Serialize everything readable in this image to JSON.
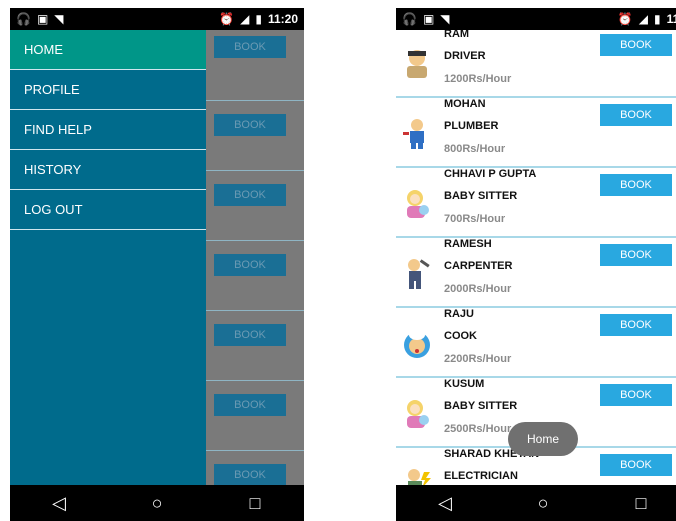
{
  "status": {
    "time_left": "11:20",
    "time_right": "11:2"
  },
  "drawer": {
    "items": [
      {
        "label": "HOME",
        "active": true
      },
      {
        "label": "PROFILE"
      },
      {
        "label": "FIND HELP"
      },
      {
        "label": "HISTORY"
      },
      {
        "label": "LOG OUT"
      }
    ]
  },
  "book_label": "BOOK",
  "list": {
    "items": [
      {
        "name": "RAM",
        "profession": "DRIVER",
        "rate": "1200Rs/Hour",
        "icon": "driver-avatar-icon"
      },
      {
        "name": "MOHAN",
        "profession": "PLUMBER",
        "rate": "800Rs/Hour",
        "icon": "plumber-avatar-icon"
      },
      {
        "name": "CHHAVI P GUPTA",
        "profession": "BABY SITTER",
        "rate": "700Rs/Hour",
        "icon": "baby-sitter-avatar-icon"
      },
      {
        "name": "RAMESH",
        "profession": "CARPENTER",
        "rate": "2000Rs/Hour",
        "icon": "carpenter-avatar-icon"
      },
      {
        "name": "RAJU",
        "profession": "COOK",
        "rate": "2200Rs/Hour",
        "icon": "cook-avatar-icon"
      },
      {
        "name": "KUSUM",
        "profession": "BABY SITTER",
        "rate": "2500Rs/Hour",
        "icon": "baby-sitter-avatar-icon"
      },
      {
        "name": "SHARAD KHETAN",
        "profession": "ELECTRICIAN",
        "rate": "",
        "icon": "electrician-avatar-icon"
      }
    ]
  },
  "toast": "Home",
  "colors": {
    "drawer_bg": "#006b8c",
    "active_item": "#009688",
    "book_button": "#29a8e0"
  }
}
